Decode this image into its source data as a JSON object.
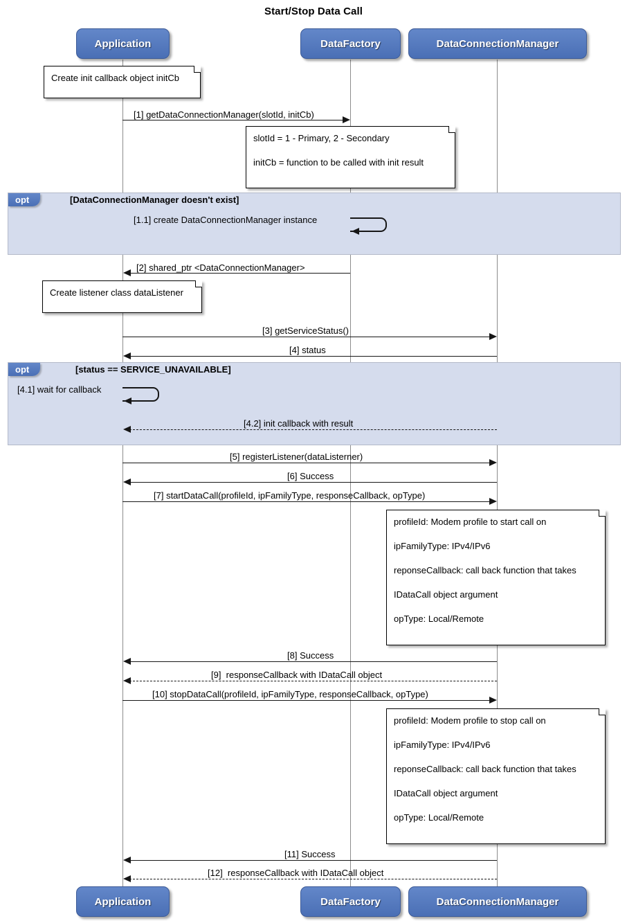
{
  "title": "Start/Stop Data Call",
  "participants": [
    {
      "name": "Application",
      "label": "Application"
    },
    {
      "name": "DataFactory",
      "label": "DataFactory"
    },
    {
      "name": "DataConnectionManager",
      "label": "DataConnectionManager"
    }
  ],
  "participants_bottom": [
    {
      "label": "Application"
    },
    {
      "label": "DataFactory"
    },
    {
      "label": "DataConnectionManager"
    }
  ],
  "notes": [
    {
      "id": "note-init-callback",
      "lines": [
        "Create init callback object initCb"
      ]
    },
    {
      "id": "note-slotid-initcb",
      "lines": [
        "slotId = 1 - Primary, 2 - Secondary",
        "initCb = function to be called with init result"
      ]
    },
    {
      "id": "note-listener",
      "lines": [
        "Create listener class dataListener"
      ]
    },
    {
      "id": "note-start-params",
      "lines": [
        "profileId: Modem profile to start call on",
        "ipFamilyType: IPv4/IPv6",
        "reponseCallback: call back function that takes",
        "IDataCall object argument",
        "opType: Local/Remote"
      ]
    },
    {
      "id": "note-stop-params",
      "lines": [
        "profileId: Modem profile to stop call on",
        "ipFamilyType: IPv4/IPv6",
        "reponseCallback: call back function that takes",
        "IDataCall object argument",
        "opType: Local/Remote"
      ]
    }
  ],
  "fragments": [
    {
      "id": "opt-dcm-not-exist",
      "operator": "opt",
      "condition": "[DataConnectionManager doesn't exist]"
    },
    {
      "id": "opt-service-unavailable",
      "operator": "opt",
      "condition": "[status == SERVICE_UNAVAILABLE]"
    }
  ],
  "messages": [
    {
      "id": "m1",
      "label": "[1] getDataConnectionManager(slotId, initCb)",
      "from": "Application",
      "to": "DataFactory",
      "style": "solid",
      "direction": "right"
    },
    {
      "id": "m11",
      "label": "[1.1] create DataConnectionManager instance",
      "from": "DataFactory",
      "to": "DataFactory",
      "style": "solid",
      "direction": "self"
    },
    {
      "id": "m2",
      "label": "[2] shared_ptr <DataConnectionManager>",
      "from": "DataFactory",
      "to": "Application",
      "style": "solid",
      "direction": "left"
    },
    {
      "id": "m3",
      "label": "[3] getServiceStatus()",
      "from": "Application",
      "to": "DataConnectionManager",
      "style": "solid",
      "direction": "right"
    },
    {
      "id": "m4",
      "label": "[4] status",
      "from": "DataConnectionManager",
      "to": "Application",
      "style": "solid",
      "direction": "left"
    },
    {
      "id": "m41",
      "label": "[4.1] wait for callback",
      "from": "Application",
      "to": "Application",
      "style": "solid",
      "direction": "self"
    },
    {
      "id": "m42",
      "label": "[4.2] init callback with result",
      "from": "DataConnectionManager",
      "to": "Application",
      "style": "dashed",
      "direction": "left"
    },
    {
      "id": "m5",
      "label": "[5] registerListener(dataListerner)",
      "from": "Application",
      "to": "DataConnectionManager",
      "style": "solid",
      "direction": "right"
    },
    {
      "id": "m6",
      "label": "[6] Success",
      "from": "DataConnectionManager",
      "to": "Application",
      "style": "solid",
      "direction": "left"
    },
    {
      "id": "m7",
      "label": "[7] startDataCall(profileId, ipFamilyType, responseCallback, opType)",
      "from": "Application",
      "to": "DataConnectionManager",
      "style": "solid",
      "direction": "right"
    },
    {
      "id": "m8",
      "label": "[8] Success",
      "from": "DataConnectionManager",
      "to": "Application",
      "style": "solid",
      "direction": "left"
    },
    {
      "id": "m9",
      "label": "[9]  responseCallback with IDataCall object",
      "from": "DataConnectionManager",
      "to": "Application",
      "style": "dashed",
      "direction": "left"
    },
    {
      "id": "m10",
      "label": "[10] stopDataCall(profileId, ipFamilyType, responseCallback, opType)",
      "from": "Application",
      "to": "DataConnectionManager",
      "style": "solid",
      "direction": "right"
    },
    {
      "id": "m11b",
      "label": "[11] Success",
      "from": "DataConnectionManager",
      "to": "Application",
      "style": "solid",
      "direction": "left"
    },
    {
      "id": "m12",
      "label": "[12]  responseCallback with IDataCall object",
      "from": "DataConnectionManager",
      "to": "Application",
      "style": "dashed",
      "direction": "left"
    }
  ],
  "colors": {
    "participant_fill": "#5179bf",
    "participant_text": "#ffffff",
    "fragment_fill": "#d5dced",
    "fragment_border": "#b3b9c9",
    "lifeline": "#8c8c8c",
    "message": "#161616",
    "note_fill": "#ffffff"
  }
}
